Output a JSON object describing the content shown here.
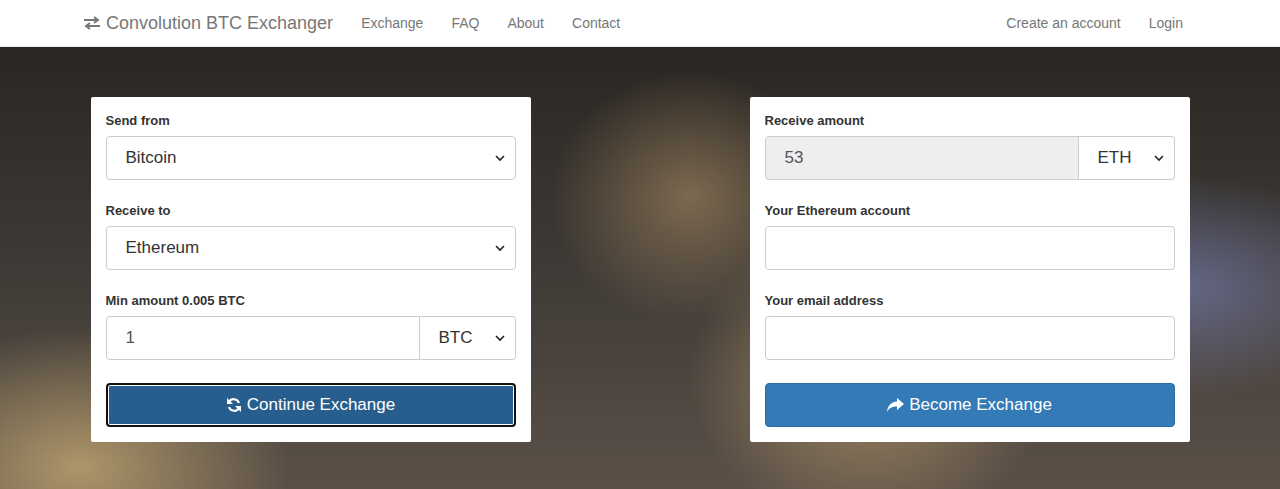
{
  "navbar": {
    "brand": "Convolution BTC Exchanger",
    "links": [
      {
        "label": "Exchange",
        "selected": false
      },
      {
        "label": "FAQ",
        "selected": false
      },
      {
        "label": "About",
        "selected": false
      },
      {
        "label": "Contact",
        "selected": false
      }
    ],
    "account_links": [
      "Create an account",
      "Login"
    ]
  },
  "send_panel": {
    "send_from": {
      "label": "Send from",
      "value": "Bitcoin"
    },
    "receive_to": {
      "label": "Receive to",
      "value": "Ethereum"
    },
    "amount": {
      "label": "Min amount 0.005 BTC",
      "value": "1",
      "unit": "BTC"
    },
    "button": {
      "label": "Continue Exchange",
      "focused": true
    }
  },
  "receive_panel": {
    "receive_amount": {
      "label": "Receive amount",
      "value": "53",
      "unit": "ETH",
      "disabled": true
    },
    "account": {
      "label": "Your Ethereum account",
      "value": ""
    },
    "email": {
      "label": "Your email address",
      "value": ""
    },
    "button": {
      "label": "Become Exchange"
    }
  }
}
